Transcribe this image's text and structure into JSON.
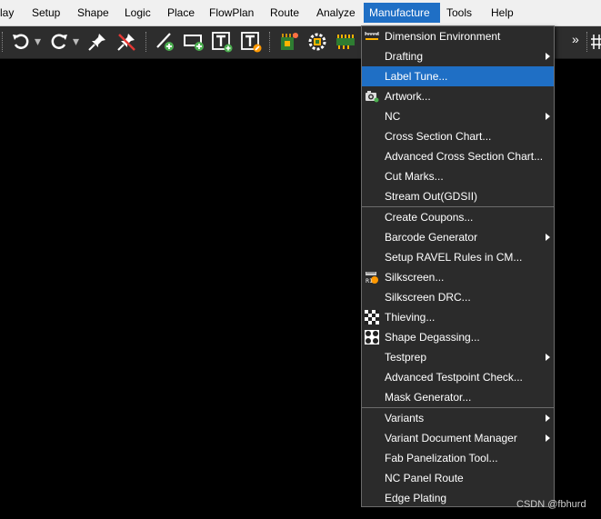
{
  "menubar": {
    "items": [
      "lay",
      "Setup",
      "Shape",
      "Logic",
      "Place",
      "FlowPlan",
      "Route",
      "Analyze",
      "Manufacture",
      "Tools",
      "Help"
    ],
    "active": "Manufacture"
  },
  "toolbar": {
    "icons": [
      "undo-icon",
      "redo-icon",
      "pin-icon",
      "unpin-icon",
      "add-line-icon",
      "add-rect-icon",
      "add-text-icon",
      "edit-text-icon",
      "chip-icon",
      "gear-chip-icon",
      "connector-icon"
    ],
    "overflow": "»"
  },
  "manufacture_menu": {
    "items": [
      {
        "label": "Dimension Environment",
        "icon": "dimension-icon"
      },
      {
        "label": "Drafting",
        "submenu": true
      },
      {
        "label": "Label Tune...",
        "selected": true
      },
      {
        "label": "Artwork...",
        "icon": "artwork-icon"
      },
      {
        "label": "NC",
        "submenu": true
      },
      {
        "label": "Cross Section Chart..."
      },
      {
        "label": "Advanced Cross Section Chart..."
      },
      {
        "label": "Cut Marks..."
      },
      {
        "label": "Stream Out(GDSII)"
      },
      {
        "label": "Create Coupons..."
      },
      {
        "label": "Barcode Generator",
        "submenu": true
      },
      {
        "label": "Setup RAVEL Rules in CM..."
      },
      {
        "label": "Silkscreen...",
        "icon": "silkscreen-icon"
      },
      {
        "label": "Silkscreen DRC..."
      },
      {
        "label": "Thieving...",
        "icon": "thieving-icon"
      },
      {
        "label": "Shape Degassing...",
        "icon": "degassing-icon"
      },
      {
        "label": "Testprep",
        "submenu": true
      },
      {
        "label": "Advanced Testpoint Check..."
      },
      {
        "label": "Mask Generator..."
      },
      {
        "label": "Variants",
        "submenu": true
      },
      {
        "label": "Variant Document Manager",
        "submenu": true
      },
      {
        "label": "Fab Panelization Tool..."
      },
      {
        "label": "NC Panel Route"
      },
      {
        "label": "Edge Plating"
      }
    ]
  },
  "watermark": "CSDN @fbhurd",
  "colors": {
    "accent": "#1f6fc5",
    "menu_bg": "#2b2b2b",
    "toolbar_bg": "#2d2d2d"
  }
}
